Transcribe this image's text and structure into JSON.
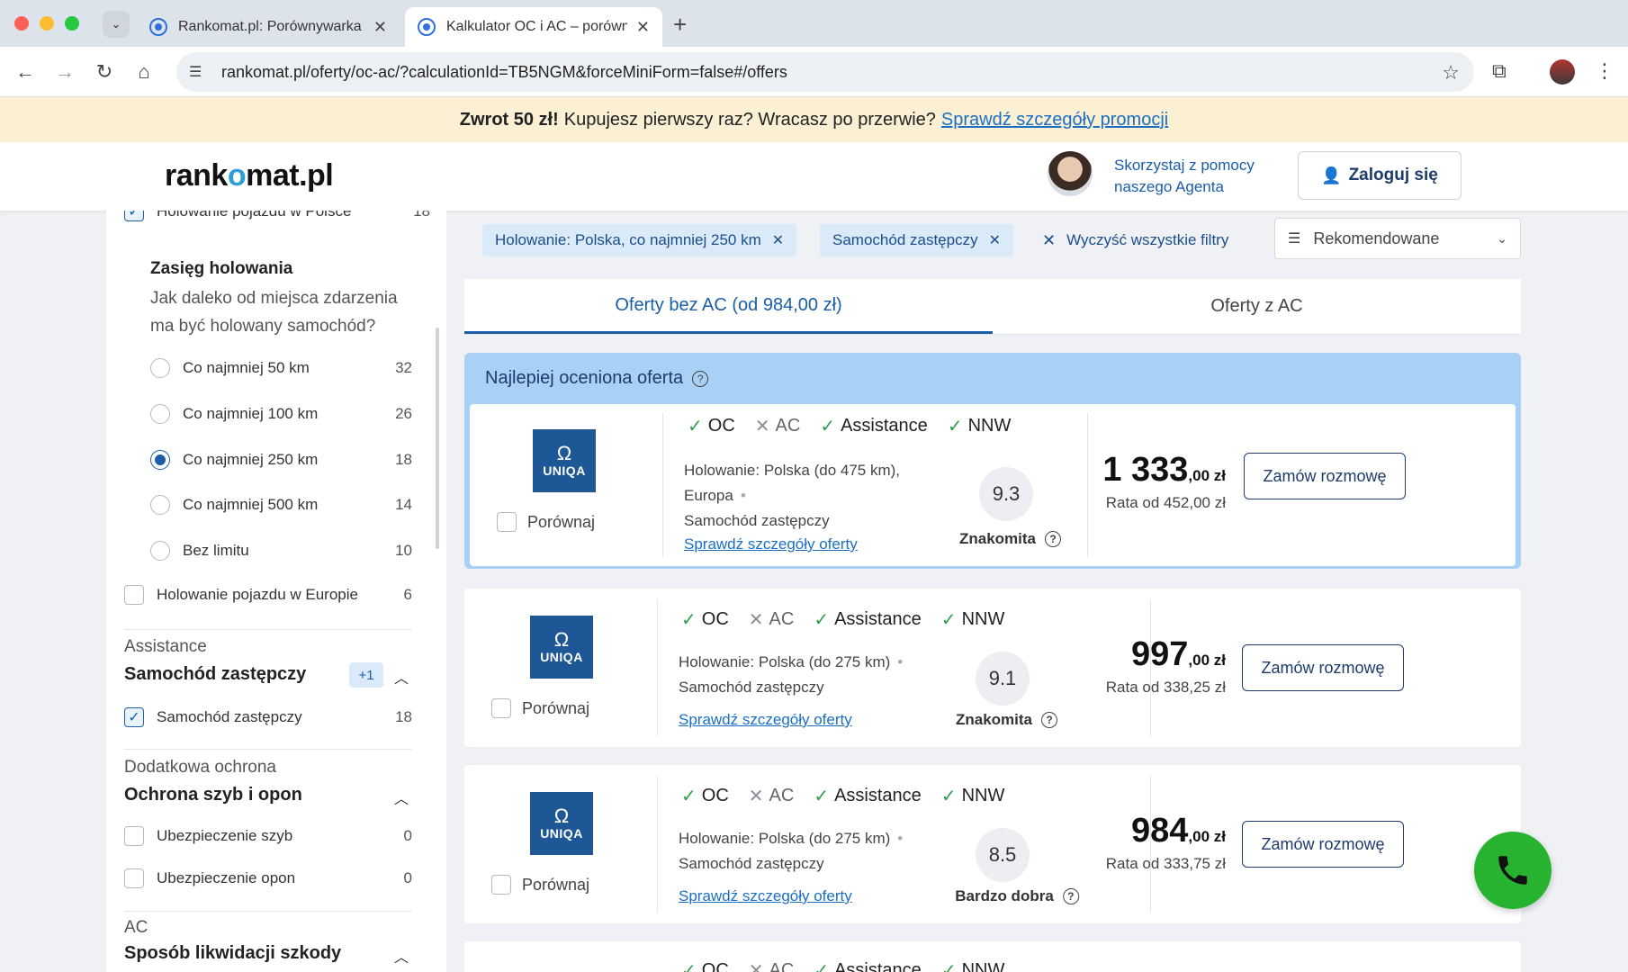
{
  "browser": {
    "tabs": [
      {
        "title": "Rankomat.pl: Porównywarka C"
      },
      {
        "title": "Kalkulator OC i AC – porówna"
      }
    ],
    "url": "rankomat.pl/oferty/oc-ac/?calculationId=TB5NGM&forceMiniForm=false#/offers"
  },
  "promo": {
    "bold": "Zwrot 50 zł!",
    "text": "Kupujesz pierwszy raz? Wracasz po przerwie?",
    "link": "Sprawdź szczegóły promocji"
  },
  "header": {
    "logo_pre": "rank",
    "logo_o": "o",
    "logo_post": "mat.pl",
    "agent_text": "Skorzystaj z pomocy naszego Agenta",
    "login": "Zaloguj się"
  },
  "sidebar": {
    "top_item": {
      "label": "Holowanie pojazdu w Polsce",
      "count": "18"
    },
    "range_title": "Zasięg holowania",
    "range_question": "Jak daleko od miejsca zdarzenia ma być holowany samochód?",
    "range_options": [
      {
        "label": "Co najmniej 50 km",
        "count": "32",
        "selected": false
      },
      {
        "label": "Co najmniej 100 km",
        "count": "26",
        "selected": false
      },
      {
        "label": "Co najmniej 250 km",
        "count": "18",
        "selected": true
      },
      {
        "label": "Co najmniej 500 km",
        "count": "14",
        "selected": false
      },
      {
        "label": "Bez limitu",
        "count": "10",
        "selected": false
      }
    ],
    "europe": {
      "label": "Holowanie pojazdu w Europie",
      "count": "6"
    },
    "assistance_section": "Assistance",
    "assistance_head": "Samochód zastępczy",
    "assistance_badge": "+1",
    "replacement_car": {
      "label": "Samochód zastępczy",
      "count": "18"
    },
    "extra_section": "Dodatkowa ochrona",
    "extra_head": "Ochrona szyb i opon",
    "glass": {
      "label": "Ubezpieczenie szyb",
      "count": "0"
    },
    "tires": {
      "label": "Ubezpieczenie opon",
      "count": "0"
    },
    "ac_section": "AC",
    "ac_head": "Sposób likwidacji szkody"
  },
  "filters": {
    "chips": [
      "Holowanie: Polska, co najmniej 250 km",
      "Samochód zastępczy"
    ],
    "clear_all": "Wyczyść wszystkie filtry",
    "sort": "Rekomendowane"
  },
  "tabs": {
    "without_ac": "Oferty bez AC (od 984,00 zł)",
    "with_ac": "Oferty z AC"
  },
  "best_label": "Najlepiej oceniona oferta",
  "coverage": {
    "oc": "OC",
    "ac": "AC",
    "assistance": "Assistance",
    "nnw": "NNW"
  },
  "insurer": "UNIQA",
  "compare": "Porównaj",
  "details_link": "Sprawdź szczegóły oferty",
  "order": "Zamów rozmowę",
  "offers": [
    {
      "desc1": "Holowanie: Polska (do 475 km),",
      "desc2": "Europa",
      "desc3": "Samochód zastępczy",
      "score": "9.3",
      "score_label": "Znakomita",
      "price_main": "1 333",
      "price_frac": ",00 zł",
      "rata": "Rata od 452,00 zł"
    },
    {
      "desc1": "Holowanie: Polska (do 275 km)",
      "desc3": "Samochód zastępczy",
      "score": "9.1",
      "score_label": "Znakomita",
      "price_main": "997",
      "price_frac": ",00 zł",
      "rata": "Rata od 338,25 zł"
    },
    {
      "desc1": "Holowanie: Polska (do 275 km)",
      "desc3": "Samochód zastępczy",
      "score": "8.5",
      "score_label": "Bardzo dobra",
      "price_main": "984",
      "price_frac": ",00 zł",
      "rata": "Rata od 333,75 zł"
    }
  ]
}
